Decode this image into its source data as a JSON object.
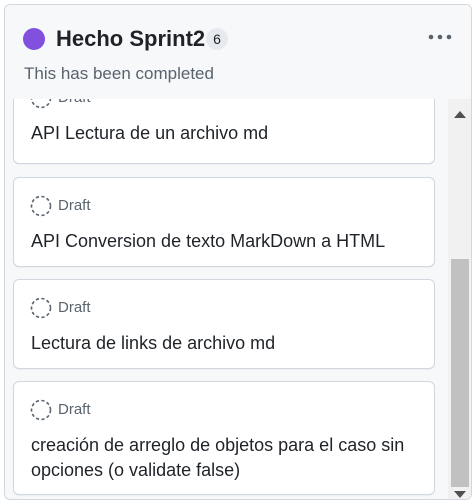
{
  "column": {
    "status_color": "#8250df",
    "title": "Hecho Sprint2",
    "count": "6",
    "description": "This has been completed",
    "menu_icon": "kebab-horizontal-icon"
  },
  "cards": [
    {
      "status": "Draft",
      "title": "API Lectura de un archivo md",
      "icon": "draft-issue-icon"
    },
    {
      "status": "Draft",
      "title": "API Conversion de texto MarkDown a HTML",
      "icon": "draft-issue-icon"
    },
    {
      "status": "Draft",
      "title": "Lectura de links de archivo md",
      "icon": "draft-issue-icon"
    },
    {
      "status": "Draft",
      "title": "creación de arreglo de objetos para el caso sin opciones (o validate false)",
      "icon": "draft-issue-icon"
    }
  ]
}
